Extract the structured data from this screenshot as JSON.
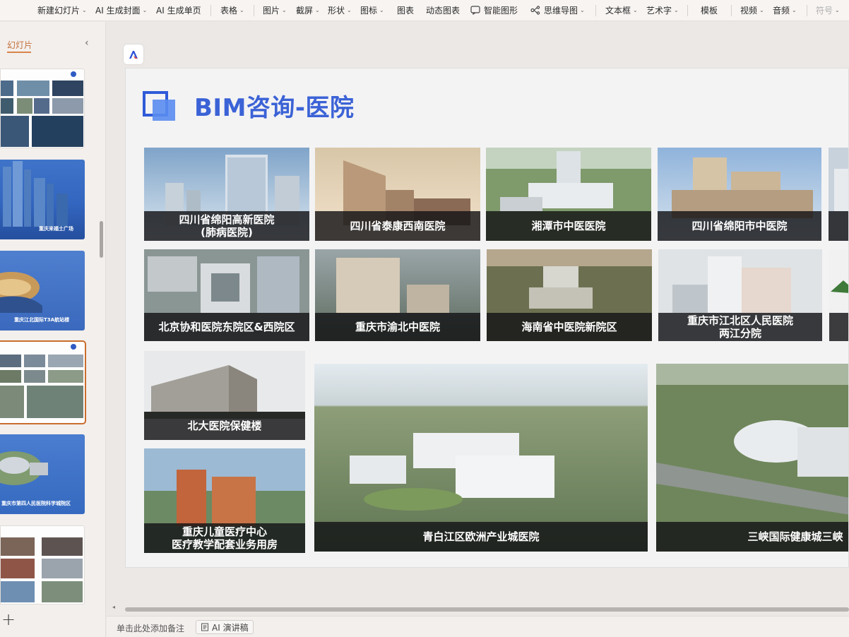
{
  "toolbar": {
    "items": [
      {
        "label": "新建幻灯片",
        "dropdown": true
      },
      {
        "label": "AI 生成封面",
        "dropdown": true
      },
      {
        "label": "AI 生成单页",
        "dropdown": false
      },
      {
        "label": "表格",
        "dropdown": true
      },
      {
        "label": "图片",
        "dropdown": true
      },
      {
        "label": "截屏",
        "dropdown": true
      },
      {
        "label": "形状",
        "dropdown": true
      },
      {
        "label": "图标",
        "dropdown": true
      },
      {
        "label": "图表",
        "dropdown": false
      },
      {
        "label": "动态图表",
        "dropdown": false
      },
      {
        "label": "智能图形",
        "dropdown": false,
        "icon": "smart-graphic-icon"
      },
      {
        "label": "思维导图",
        "dropdown": true,
        "icon": "mind-map-icon"
      },
      {
        "label": "文本框",
        "dropdown": true
      },
      {
        "label": "艺术字",
        "dropdown": true
      },
      {
        "label": "模板",
        "dropdown": false
      },
      {
        "label": "视频",
        "dropdown": true
      },
      {
        "label": "音频",
        "dropdown": true
      },
      {
        "label": "符号",
        "dropdown": true,
        "disabled": true
      }
    ]
  },
  "left_panel": {
    "title": "幻灯片",
    "collapse_icon": "chevron-left-icon",
    "add_icon": "plus-icon",
    "thumbnails": [
      {
        "caption": "",
        "selected": false
      },
      {
        "caption": "重庆来福士广场",
        "selected": false
      },
      {
        "caption": "重庆江北国际T3A航站楼",
        "selected": false
      },
      {
        "caption": "",
        "selected": true
      },
      {
        "caption": "重庆市第四人民医院科学城院区",
        "selected": false
      },
      {
        "caption": "",
        "selected": false
      }
    ]
  },
  "slide": {
    "title": "BIM咨询-医院",
    "tiles": [
      {
        "caption_lines": [
          "四川省绵阳高新医院",
          "(肺病医院)"
        ]
      },
      {
        "caption_lines": [
          "四川省泰康西南医院"
        ]
      },
      {
        "caption_lines": [
          "湘潭市中医医院"
        ]
      },
      {
        "caption_lines": [
          "四川省绵阳市中医院"
        ]
      },
      {
        "caption_lines": [
          "北京协和医院东院区&西院区"
        ]
      },
      {
        "caption_lines": [
          "重庆市渝北中医院"
        ]
      },
      {
        "caption_lines": [
          "海南省中医院新院区"
        ]
      },
      {
        "caption_lines": [
          "重庆市江北区人民医院",
          "两江分院"
        ]
      },
      {
        "caption_lines": [
          "北大医院保健楼"
        ]
      },
      {
        "caption_lines": [
          "重庆儿童医疗中心",
          "医疗教学配套业务用房"
        ]
      },
      {
        "caption_lines": [
          "青白江区欧洲产业城医院"
        ]
      },
      {
        "caption_lines": [
          "三峡国际健康城三峡"
        ]
      }
    ]
  },
  "bottom": {
    "notes_placeholder": "单击此处添加备注",
    "ai_button_label": "AI 演讲稿"
  },
  "colors": {
    "accent": "#3b62d6",
    "selection": "#c96d2e",
    "caption_bg": "#141416"
  }
}
